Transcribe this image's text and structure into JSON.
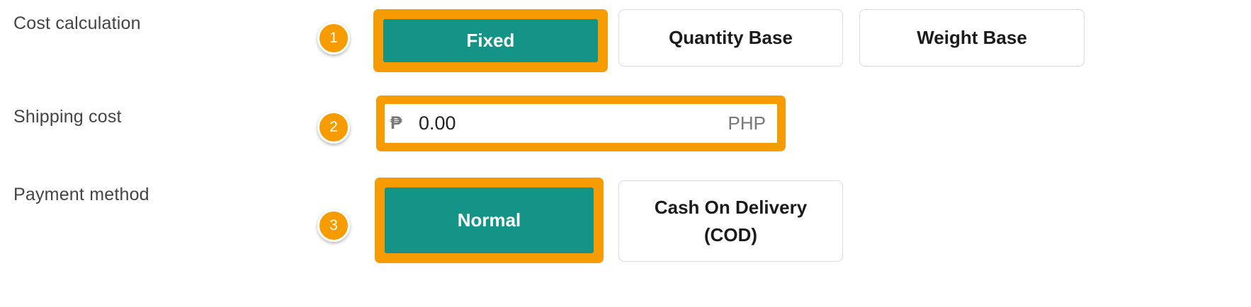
{
  "cost_calculation": {
    "label": "Cost calculation",
    "step": "1",
    "options": [
      "Fixed",
      "Quantity Base",
      "Weight Base"
    ],
    "selected": "Fixed"
  },
  "shipping_cost": {
    "label": "Shipping cost",
    "step": "2",
    "currency_symbol": "₱",
    "value": "0.00",
    "currency_code": "PHP"
  },
  "payment_method": {
    "label": "Payment method",
    "step": "3",
    "options": [
      "Normal",
      "Cash On Delivery (COD)"
    ],
    "selected": "Normal"
  },
  "colors": {
    "highlight": "#f79c00",
    "selected_fill": "#139486",
    "label_text": "#444444"
  }
}
